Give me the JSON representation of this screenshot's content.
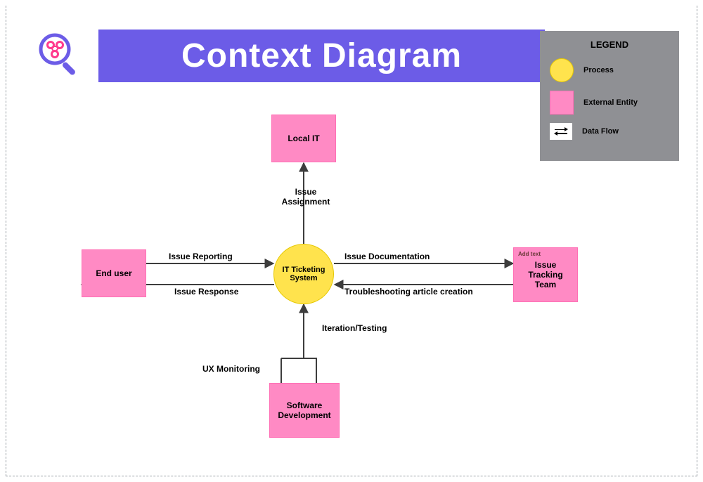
{
  "title": "Context Diagram",
  "legend": {
    "title": "LEGEND",
    "process": "Process",
    "entity": "External Entity",
    "flow": "Data Flow"
  },
  "process": {
    "it_ticketing": "IT Ticketing System"
  },
  "entities": {
    "local_it": "Local IT",
    "end_user": "End user",
    "issue_tracking": "Issue Tracking Team",
    "software_dev": "Software Development"
  },
  "flows": {
    "issue_assignment": "Issue Assignment",
    "issue_reporting": "Issue Reporting",
    "issue_response": "Issue Response",
    "issue_documentation": "Issue Documentation",
    "article_creation": "Troubleshooting article creation",
    "ux_monitoring": "UX Monitoring",
    "iteration_testing": "Iteration/Testing"
  },
  "note": "Add text"
}
